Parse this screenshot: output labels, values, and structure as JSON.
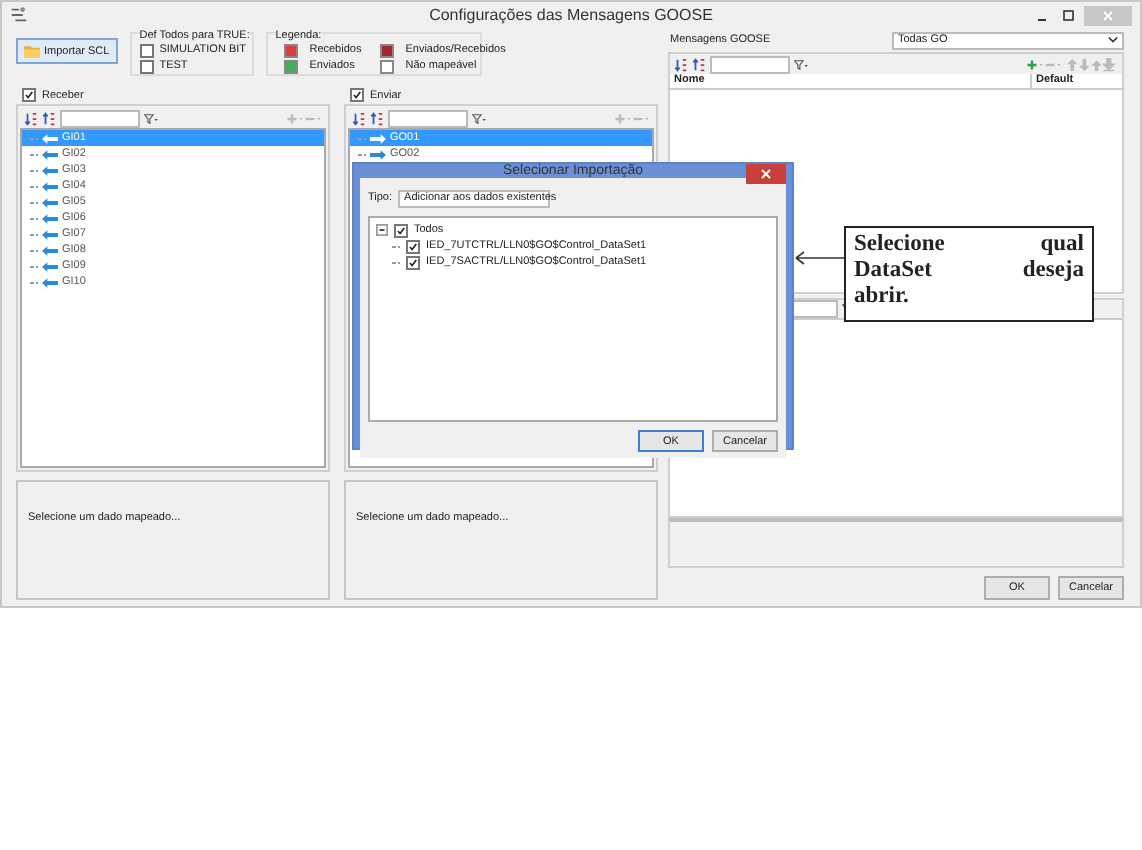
{
  "window": {
    "title": "Configurações das Mensagens GOOSE"
  },
  "import_button": "Importar SCL",
  "def_todos": {
    "label": "Def Todos para TRUE:",
    "options": [
      {
        "label": "SIMULATION BIT",
        "checked": false
      },
      {
        "label": "TEST",
        "checked": false
      }
    ]
  },
  "legend": {
    "label": "Legenda:",
    "items": [
      {
        "label": "Recebidos",
        "color": "#e0393e"
      },
      {
        "label": "Enviados/Recebidos",
        "color": "#9e2a2e"
      },
      {
        "label": "Enviados",
        "color": "#3fae5a"
      },
      {
        "label": "Não mapeável",
        "color": "#ffffff"
      }
    ]
  },
  "receive_panel": {
    "label": "Receber",
    "checked": true,
    "items": [
      {
        "label": "GI01",
        "selected": true
      },
      {
        "label": "GI02",
        "selected": false
      },
      {
        "label": "GI03",
        "selected": false
      },
      {
        "label": "GI04",
        "selected": false
      },
      {
        "label": "GI05",
        "selected": false
      },
      {
        "label": "GI06",
        "selected": false
      },
      {
        "label": "GI07",
        "selected": false
      },
      {
        "label": "GI08",
        "selected": false
      },
      {
        "label": "GI09",
        "selected": false
      },
      {
        "label": "GI10",
        "selected": false
      }
    ],
    "detail": "Selecione um dado mapeado..."
  },
  "send_panel": {
    "label": "Enviar",
    "checked": true,
    "items": [
      {
        "label": "GO01",
        "selected": true
      },
      {
        "label": "GO02",
        "selected": false
      }
    ],
    "detail": "Selecione um dado mapeado..."
  },
  "goose_panel": {
    "label": "Mensagens GOOSE",
    "filter": "Todas GO",
    "columns": [
      "Nome",
      "Default"
    ]
  },
  "dialog": {
    "title": "Selecionar Importação",
    "type_label": "Tipo:",
    "type_value": "Adicionar aos dados existentes",
    "tree": {
      "label": "Todos",
      "checked": true,
      "expanded": true,
      "children": [
        {
          "label": "IED_7UTCTRL/LLN0$GO$Control_DataSet1",
          "checked": true
        },
        {
          "label": "IED_7SACTRL/LLN0$GO$Control_DataSet1",
          "checked": true
        }
      ]
    },
    "buttons": [
      "OK",
      "Cancelar"
    ]
  },
  "callout": {
    "lines": [
      "Selecione qual",
      "DataSet deseja",
      "abrir."
    ]
  },
  "footer_buttons": [
    "OK",
    "Cancelar"
  ]
}
